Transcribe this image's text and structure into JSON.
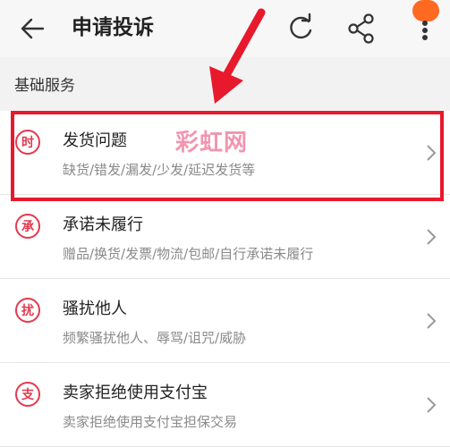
{
  "header": {
    "title": "申请投诉",
    "back_icon": "arrow-left-icon",
    "refresh_icon": "refresh-icon",
    "share_icon": "share-icon",
    "more_icon": "more-vertical-icon"
  },
  "section": {
    "label": "基础服务"
  },
  "items": [
    {
      "icon_text": "时",
      "title": "发货问题",
      "subtitle": "缺货/错发/漏发/少发/延迟发货等"
    },
    {
      "icon_text": "承",
      "title": "承诺未履行",
      "subtitle": "赠品/换货/发票/物流/包邮/自行承诺未履行"
    },
    {
      "icon_text": "扰",
      "title": "骚扰他人",
      "subtitle": "频繁骚扰他人、辱骂/诅咒/威胁"
    },
    {
      "icon_text": "支",
      "title": "卖家拒绝使用支付宝",
      "subtitle": "卖家拒绝使用支付宝担保交易"
    }
  ],
  "watermark": "彩虹网",
  "colors": {
    "accent": "#e23a4f",
    "highlight": "#e8192c",
    "badge": "#ff6a22",
    "watermark": "#f08aa8"
  }
}
